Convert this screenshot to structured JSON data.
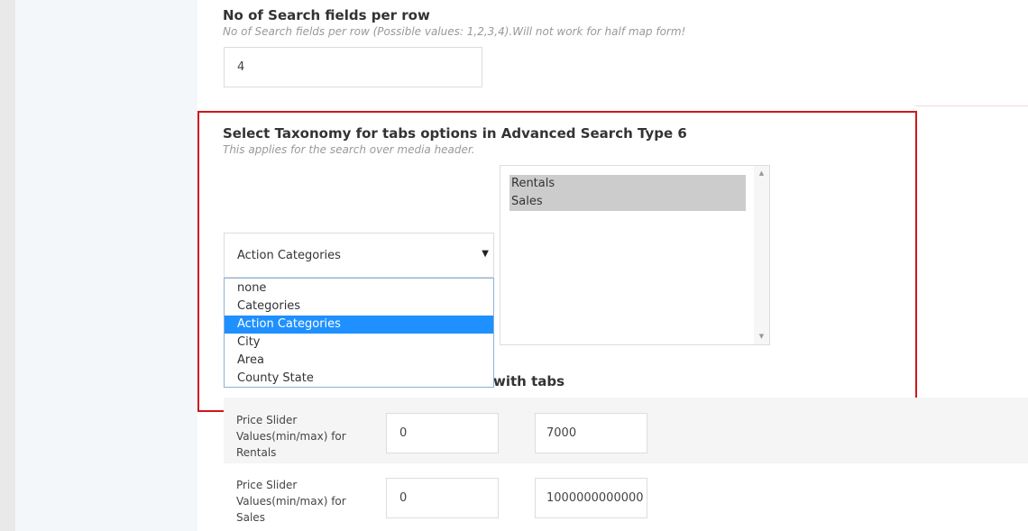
{
  "search_fields": {
    "title": "No of Search fields per row",
    "description": "No of Search fields per row (Possible values: 1,2,3,4).Will not work for half map form!",
    "value": "4"
  },
  "taxonomy": {
    "title": "Select Taxonomy for tabs options in Advanced Search Type 6",
    "description": "This applies for the search over media header.",
    "selected": "Action Categories",
    "options": [
      "none",
      "Categories",
      "Action Categories",
      "City",
      "Area",
      "County State"
    ],
    "selected_terms": [
      "Rentals",
      "Sales"
    ]
  },
  "tabs_section": {
    "partial_label": "with tabs"
  },
  "price_rows": [
    {
      "label": "Price Slider Values(min/max) for Rentals",
      "min": "0",
      "max": "7000"
    },
    {
      "label": "Price Slider Values(min/max) for Sales",
      "min": "0",
      "max": "1000000000000"
    }
  ],
  "colors": {
    "highlight_border": "#d0161c",
    "selected_option": "#1e90ff",
    "selected_term": "#cccccc"
  },
  "icons": {
    "dropdown_arrow": "caret-down-icon",
    "scroll_up": "scroll-up-arrow-icon",
    "scroll_down": "scroll-down-arrow-icon"
  }
}
